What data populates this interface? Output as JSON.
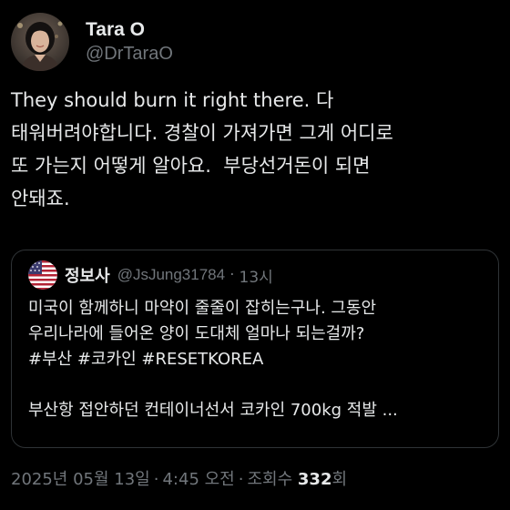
{
  "author": {
    "name": "Tara O",
    "handle": "@DrTaraO"
  },
  "tweet": {
    "text": "They should burn it right there. 다\n태워버려야합니다. 경찰이 가져가면 그게 어디로\n또 가는지 어떻게 알아요.  부당선거돈이 되면\n안돼죠."
  },
  "quote": {
    "name": "정보사",
    "handle": "@JsJung31784",
    "separator": "·",
    "time": "13시",
    "text": "미국이 함께하니 마약이 줄줄이 잡히는구나. 그동안\n우리나라에 들어온 양이 도대체 얼마나 되는걸까?\n#부산 #코카인 #RESETKOREA\n\n부산항 접안하던 컨테이너선서 코카인 700kg 적발 ..."
  },
  "meta": {
    "date": "2025년 05월 13일",
    "separator": "·",
    "time": "4:45 오전",
    "views_label": "조회수",
    "views_count": "332",
    "views_suffix": "회"
  },
  "colors": {
    "background": "#000000",
    "text_primary": "#e7e9ea",
    "text_secondary": "#71767b",
    "border": "#2f3336"
  },
  "icons": {
    "author_avatar": "profile-photo",
    "quote_avatar": "us-flag"
  }
}
